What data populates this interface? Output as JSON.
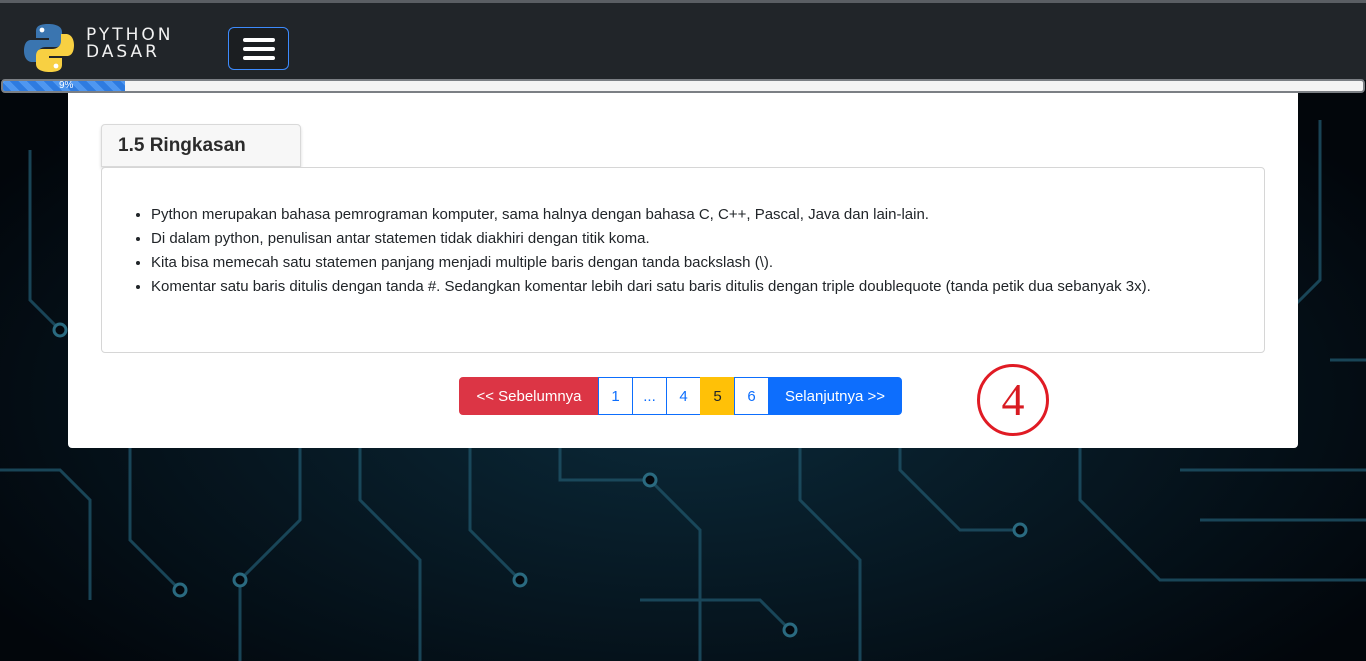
{
  "header": {
    "brand_line1": "PYTHON",
    "brand_line2": "DASAR",
    "menu_icon": "hamburger-icon",
    "logo_icon": "python-logo"
  },
  "progress": {
    "value_percent": 9,
    "label": "9%"
  },
  "section": {
    "title": "1.5 Ringkasan",
    "items": [
      "Python merupakan bahasa pemrograman komputer, sama halnya dengan bahasa C, C++, Pascal, Java dan lain-lain.",
      "Di dalam python, penulisan antar statemen tidak diakhiri dengan titik koma.",
      "Kita bisa memecah satu statemen panjang menjadi multiple baris dengan tanda backslash (\\).",
      "Komentar satu baris ditulis dengan tanda #. Sedangkan komentar lebih dari satu baris ditulis dengan triple doublequote (tanda petik dua sebanyak 3x)."
    ]
  },
  "pagination": {
    "prev_label": "<< Sebelumnya",
    "pages": [
      "1",
      "...",
      "4",
      "5",
      "6"
    ],
    "active_page": "5",
    "next_label": "Selanjutnya >>"
  },
  "annotation": {
    "label": "4"
  },
  "colors": {
    "navbar": "#212529",
    "prev_button": "#dc3545",
    "next_button": "#0d6efd",
    "active_page": "#ffc107",
    "annotation": "#e01b24"
  }
}
